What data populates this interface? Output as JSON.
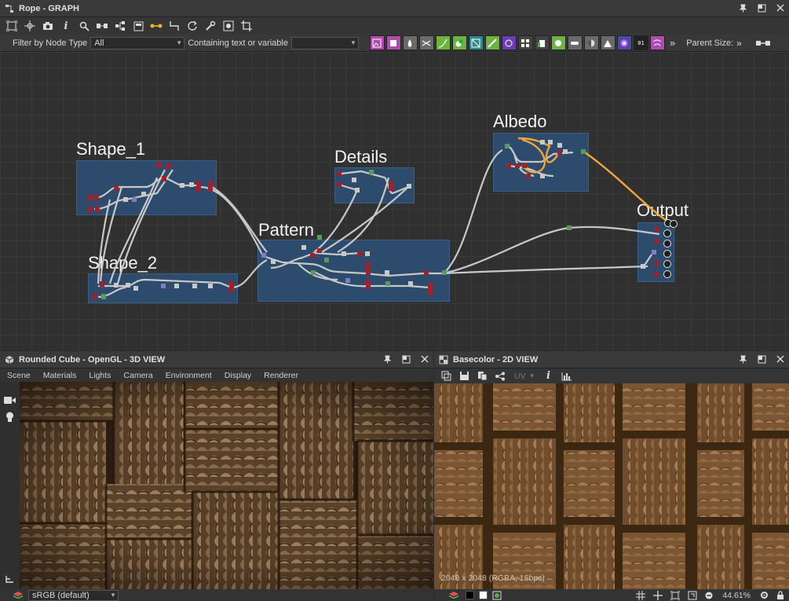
{
  "graph_panel": {
    "title": "Rope - GRAPH",
    "filter": {
      "label": "Filter by Node Type",
      "value": "All",
      "text_label": "Containing text or variable",
      "text_value": ""
    },
    "parent_size_label": "Parent Size:",
    "overflow_label": "»",
    "frames": [
      {
        "name": "Shape_1"
      },
      {
        "name": "Shape_2"
      },
      {
        "name": "Details"
      },
      {
        "name": "Pattern"
      },
      {
        "name": "Albedo"
      },
      {
        "name": "Output"
      }
    ]
  },
  "view3d_panel": {
    "title": "Rounded Cube - OpenGL - 3D VIEW",
    "menu": [
      "Scene",
      "Materials",
      "Lights",
      "Camera",
      "Environment",
      "Display",
      "Renderer"
    ],
    "colorspace": "sRGB (default)"
  },
  "view2d_panel": {
    "title": "Basecolor - 2D VIEW",
    "uv_label": "UV",
    "resolution_info": "2048 x 2048 (RGBA, 16bpc)",
    "zoom": "44.61%"
  },
  "colors": {
    "frame_fill": "#2d4d6f",
    "wire": "#c8c8c8",
    "wire_highlight": "#f0a63a",
    "node_red": "#a3202a",
    "node_gray": "#c9c9c9",
    "node_green": "#5a9b5a"
  }
}
